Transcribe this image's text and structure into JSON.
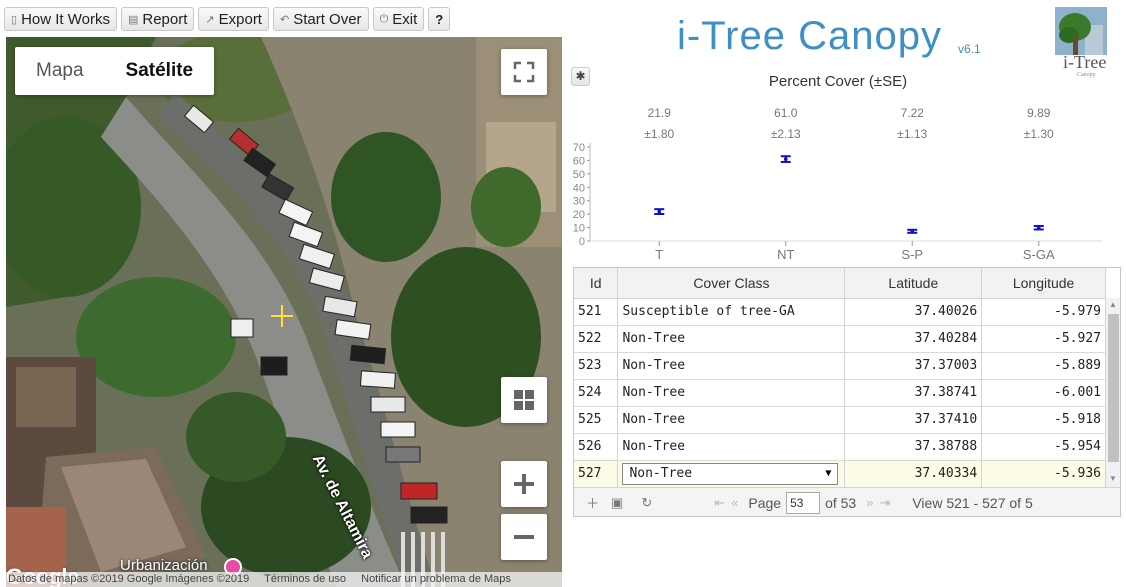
{
  "toolbar": {
    "how_it_works": "How It Works",
    "report": "Report",
    "export": "Export",
    "start_over": "Start Over",
    "exit": "Exit",
    "help": "?"
  },
  "map": {
    "type_map": "Mapa",
    "type_satellite": "Satélite",
    "active_type": "Satélite",
    "street_label": "Av. de Altamira",
    "poi_label": "Urbanización",
    "google_logo": "Google",
    "attribution": {
      "data": "Datos de mapas ©2019 Google Imágenes ©2019",
      "terms": "Términos de uso",
      "report": "Notificar un problema de Maps"
    }
  },
  "brand": {
    "title": "i-Tree Canopy",
    "version": "v6.1",
    "logo_text": "i-Tree",
    "logo_sub": "Canopy",
    "color": "#3d8fc6"
  },
  "chart_data": {
    "type": "scatter",
    "title": "Percent Cover (±SE)",
    "categories": [
      "T",
      "NT",
      "S-P",
      "S-GA"
    ],
    "values": [
      21.9,
      61.0,
      7.22,
      9.89
    ],
    "errors": [
      1.8,
      2.13,
      1.13,
      1.3
    ],
    "value_labels": [
      "21.9",
      "61.0",
      "7.22",
      "9.89"
    ],
    "error_labels": [
      "±1.80",
      "±2.13",
      "±1.13",
      "±1.30"
    ],
    "yticks": [
      0,
      10,
      20,
      30,
      40,
      50,
      60,
      70
    ],
    "ylim": [
      0,
      70
    ],
    "marker_color": "#1010c8"
  },
  "grid": {
    "columns": [
      "Id",
      "Cover Class",
      "Latitude",
      "Longitude"
    ],
    "rows": [
      {
        "id": "521",
        "cls": "Susceptible of tree-GA",
        "lat": "37.40026",
        "lon": "-5.979"
      },
      {
        "id": "522",
        "cls": "Non-Tree",
        "lat": "37.40284",
        "lon": "-5.927"
      },
      {
        "id": "523",
        "cls": "Non-Tree",
        "lat": "37.37003",
        "lon": "-5.889"
      },
      {
        "id": "524",
        "cls": "Non-Tree",
        "lat": "37.38741",
        "lon": "-6.001"
      },
      {
        "id": "525",
        "cls": "Non-Tree",
        "lat": "37.37410",
        "lon": "-5.918"
      },
      {
        "id": "526",
        "cls": "Non-Tree",
        "lat": "37.38788",
        "lon": "-5.954"
      },
      {
        "id": "527",
        "cls": "Non-Tree",
        "lat": "37.40334",
        "lon": "-5.936"
      }
    ],
    "selected_row": 6,
    "pager": {
      "page_label": "Page",
      "page_value": "53",
      "of_label": "of 53",
      "view_label": "View 521 - 527 of 5"
    }
  }
}
